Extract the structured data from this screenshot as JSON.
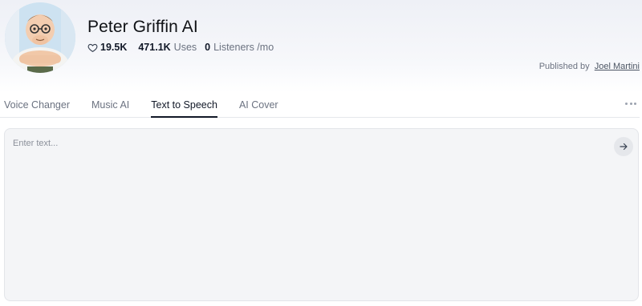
{
  "profile": {
    "title": "Peter Griffin AI",
    "likes": "19.5K",
    "uses_count": "471.1K",
    "uses_label": "Uses",
    "listeners_count": "0",
    "listeners_label": "Listeners /mo",
    "published_prefix": "Published by",
    "publisher": "Joel Martini"
  },
  "tabs": [
    {
      "label": "Voice Changer"
    },
    {
      "label": "Music AI"
    },
    {
      "label": "Text to Speech",
      "active": true
    },
    {
      "label": "AI Cover"
    }
  ],
  "editor": {
    "placeholder": "Enter text..."
  },
  "icons": {
    "likes": "heart-icon",
    "more": "more-horizontal-icon",
    "send": "arrow-right-icon"
  }
}
